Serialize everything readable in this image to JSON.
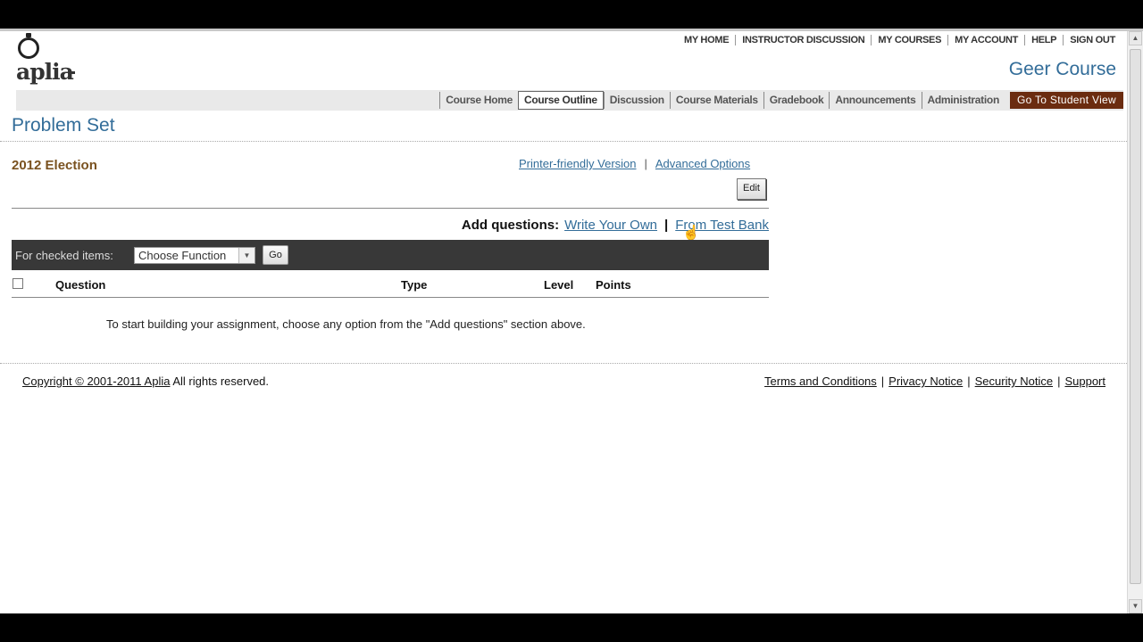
{
  "brand": {
    "logo_text": "aplia"
  },
  "header": {
    "top_links": [
      "MY HOME",
      "INSTRUCTOR DISCUSSION",
      "MY COURSES",
      "MY ACCOUNT",
      "HELP",
      "SIGN OUT"
    ],
    "course_title": "Geer Course"
  },
  "nav": {
    "tabs": [
      "Course Home",
      "Course Outline",
      "Discussion",
      "Course Materials",
      "Gradebook",
      "Announcements",
      "Administration"
    ],
    "student_view": "Go To Student View"
  },
  "page": {
    "title": "Problem Set",
    "problem_set_name": "2012 Election",
    "printer_link": "Printer-friendly Version",
    "advanced_link": "Advanced Options",
    "edit_label": "Edit"
  },
  "add_questions": {
    "label": "Add questions:",
    "write_own": "Write Your Own",
    "test_bank": "From Test Bank"
  },
  "function_bar": {
    "label": "For checked items:",
    "select_value": "Choose Function",
    "go_label": "Go"
  },
  "table": {
    "headers": {
      "question": "Question",
      "type": "Type",
      "level": "Level",
      "points": "Points"
    },
    "empty_message": "To start building your assignment, choose any option from the \"Add questions\" section above."
  },
  "footer": {
    "copyright_link": "Copyright © 2001-2011 Aplia",
    "rights": "All rights reserved.",
    "links": [
      "Terms and Conditions",
      "Privacy Notice",
      "Security Notice",
      "Support"
    ]
  },
  "colors": {
    "link": "#336d99",
    "title": "#336d99",
    "problem_set_name": "#7a5220",
    "student_view_bg": "#6b2c10",
    "function_bar_bg": "#383838"
  }
}
